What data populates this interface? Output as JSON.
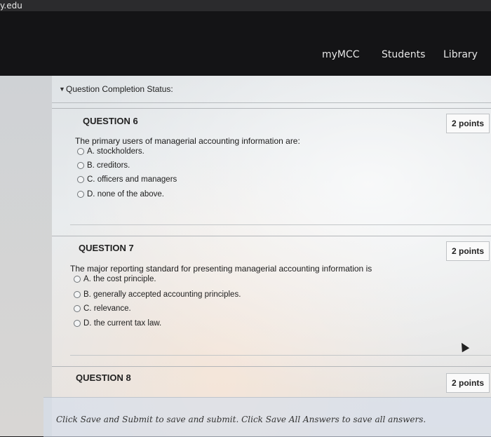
{
  "browser": {
    "url_fragment": "y.edu"
  },
  "nav": {
    "links": [
      "myMCC",
      "Students",
      "Library"
    ]
  },
  "status": {
    "label": "Question Completion Status:"
  },
  "questions": [
    {
      "title": "QUESTION 6",
      "points": "2 points",
      "text": "The primary users of managerial accounting information are:",
      "options": [
        "A. stockholders.",
        "B. creditors.",
        "C. officers and managers",
        "D. none of the above."
      ]
    },
    {
      "title": "QUESTION 7",
      "points": "2 points",
      "text": "The major reporting standard for presenting managerial accounting information is",
      "options": [
        "A. the cost principle.",
        "B. generally accepted accounting principles.",
        "C. relevance.",
        "D. the current tax law."
      ]
    },
    {
      "title": "QUESTION 8",
      "points": "2 points"
    }
  ],
  "footer": {
    "instructions": "Click Save and Submit to save and submit. Click Save All Answers to save all answers."
  }
}
